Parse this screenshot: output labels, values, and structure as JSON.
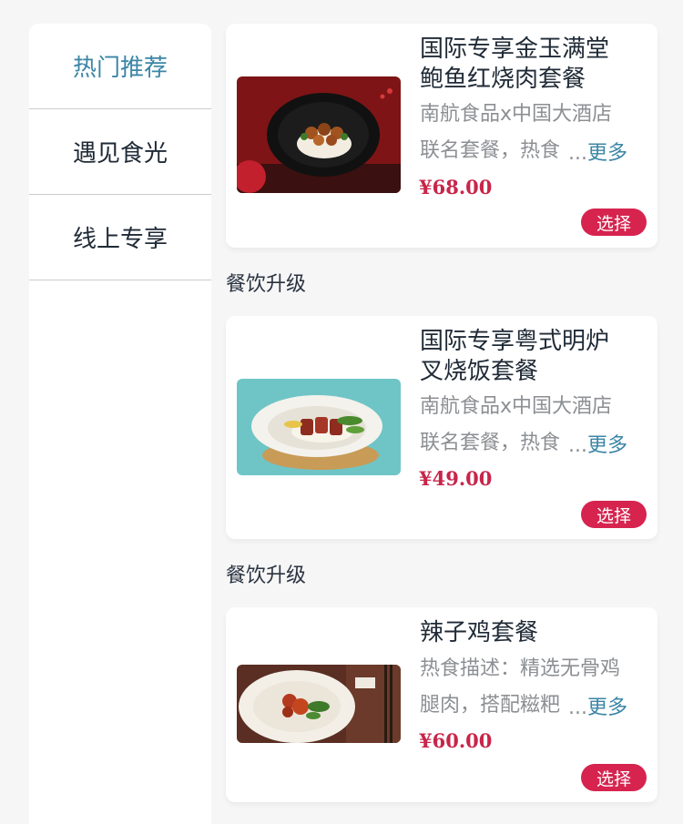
{
  "sidebar": {
    "items": [
      {
        "label": "热门推荐",
        "active": true
      },
      {
        "label": "遇见食光",
        "active": false
      },
      {
        "label": "线上专享",
        "active": false
      }
    ]
  },
  "sections": [
    {
      "label": "",
      "item": {
        "title_line1": "国际专享金玉满堂",
        "title_line2": "鲍鱼红烧肉套餐",
        "desc_line1": "南航食品x中国大酒店",
        "desc_line2": "联名套餐，热食",
        "more": "更多",
        "price": "¥68.00",
        "button": "选择"
      }
    },
    {
      "label": "餐饮升级",
      "item": {
        "title_line1": "国际专享粤式明炉",
        "title_line2": "叉烧饭套餐",
        "desc_line1": "南航食品x中国大酒店",
        "desc_line2": "联名套餐，热食",
        "more": "更多",
        "price": "¥49.00",
        "button": "选择"
      }
    },
    {
      "label": "餐饮升级",
      "item": {
        "title_line1": "辣子鸡套餐",
        "title_line2": "",
        "desc_line1": "热食描述：精选无骨鸡",
        "desc_line2": "腿肉，搭配糍粑",
        "more": "更多",
        "price": "¥60.00",
        "button": "选择"
      }
    }
  ],
  "colors": {
    "accent": "#3b86a6",
    "price": "#c8254a",
    "button": "#d6244f",
    "background": "#f6f6f7"
  }
}
